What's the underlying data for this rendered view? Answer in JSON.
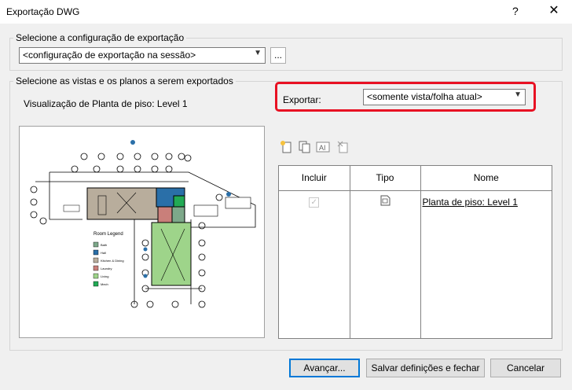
{
  "window": {
    "title": "Exportação DWG",
    "help": "?",
    "close": "✕"
  },
  "export_config": {
    "legend": "Selecione a configuração de exportação",
    "value": "<configuração de exportação na sessão>",
    "browse_label": "..."
  },
  "views": {
    "legend": "Selecione as vistas e os planos a serem exportados",
    "preview_label": "Visualização de Planta de piso: Level 1",
    "export_label": "Exportar:",
    "export_value": "<somente vista/folha atual>"
  },
  "toolbar_icons": [
    "new-set-icon",
    "duplicate-set-icon",
    "rename-set-icon",
    "delete-set-icon"
  ],
  "grid": {
    "headers": [
      "Incluir",
      "Tipo",
      "Nome"
    ],
    "rows": [
      {
        "include": true,
        "type_icon": "floor-plan-icon",
        "name": "Planta de piso: Level 1"
      }
    ]
  },
  "plan": {
    "legend_title": "Room Legend",
    "legend_items": [
      "Bath",
      "Hall",
      "Kitchen & Dining",
      "Laundry",
      "Living",
      "Mech"
    ],
    "colors": {
      "bath": "#7da88a",
      "hall": "#2a6fa8",
      "kitchen": "#b8ad9c",
      "laundry": "#c97f7a",
      "living": "#9ed48a",
      "mech": "#22aa55"
    }
  },
  "buttons": {
    "next": "Avançar...",
    "save_close": "Salvar definições e fechar",
    "cancel": "Cancelar"
  }
}
